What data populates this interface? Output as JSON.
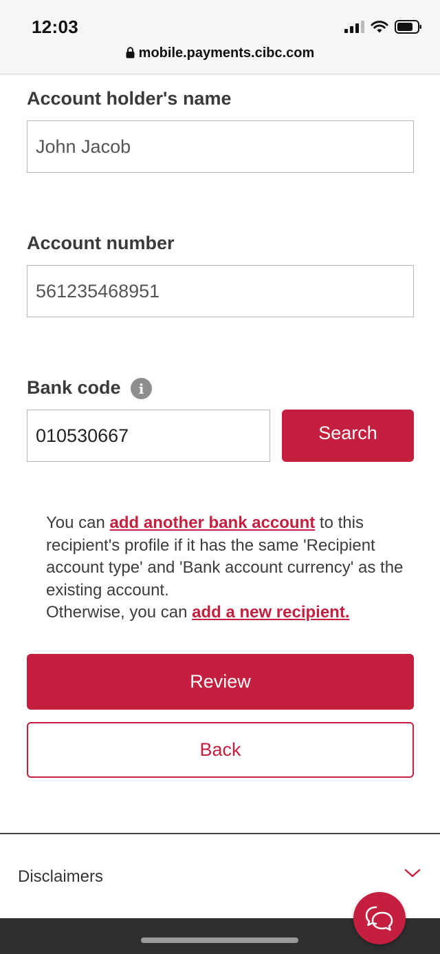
{
  "status_bar": {
    "time": "12:03"
  },
  "browser": {
    "url": "mobile.payments.cibc.com"
  },
  "form": {
    "holder_name_label": "Account holder's name",
    "holder_name_value": "John Jacob",
    "account_number_label": "Account number",
    "account_number_value": "561235468951",
    "bank_code_label": "Bank code",
    "bank_code_value": "010530667",
    "search_label": "Search"
  },
  "info": {
    "text_before": "You can ",
    "link_add_account": "add another bank account",
    "text_middle": " to this recipient's profile if it has the same 'Recipient account type' and 'Bank account currency' as the existing account.",
    "text_otherwise": "Otherwise, you can ",
    "link_new_recipient": "add a new recipient."
  },
  "actions": {
    "review_label": "Review",
    "back_label": "Back"
  },
  "footer": {
    "disclaimers_label": "Disclaimers"
  },
  "colors": {
    "accent": "#c41f3e"
  }
}
